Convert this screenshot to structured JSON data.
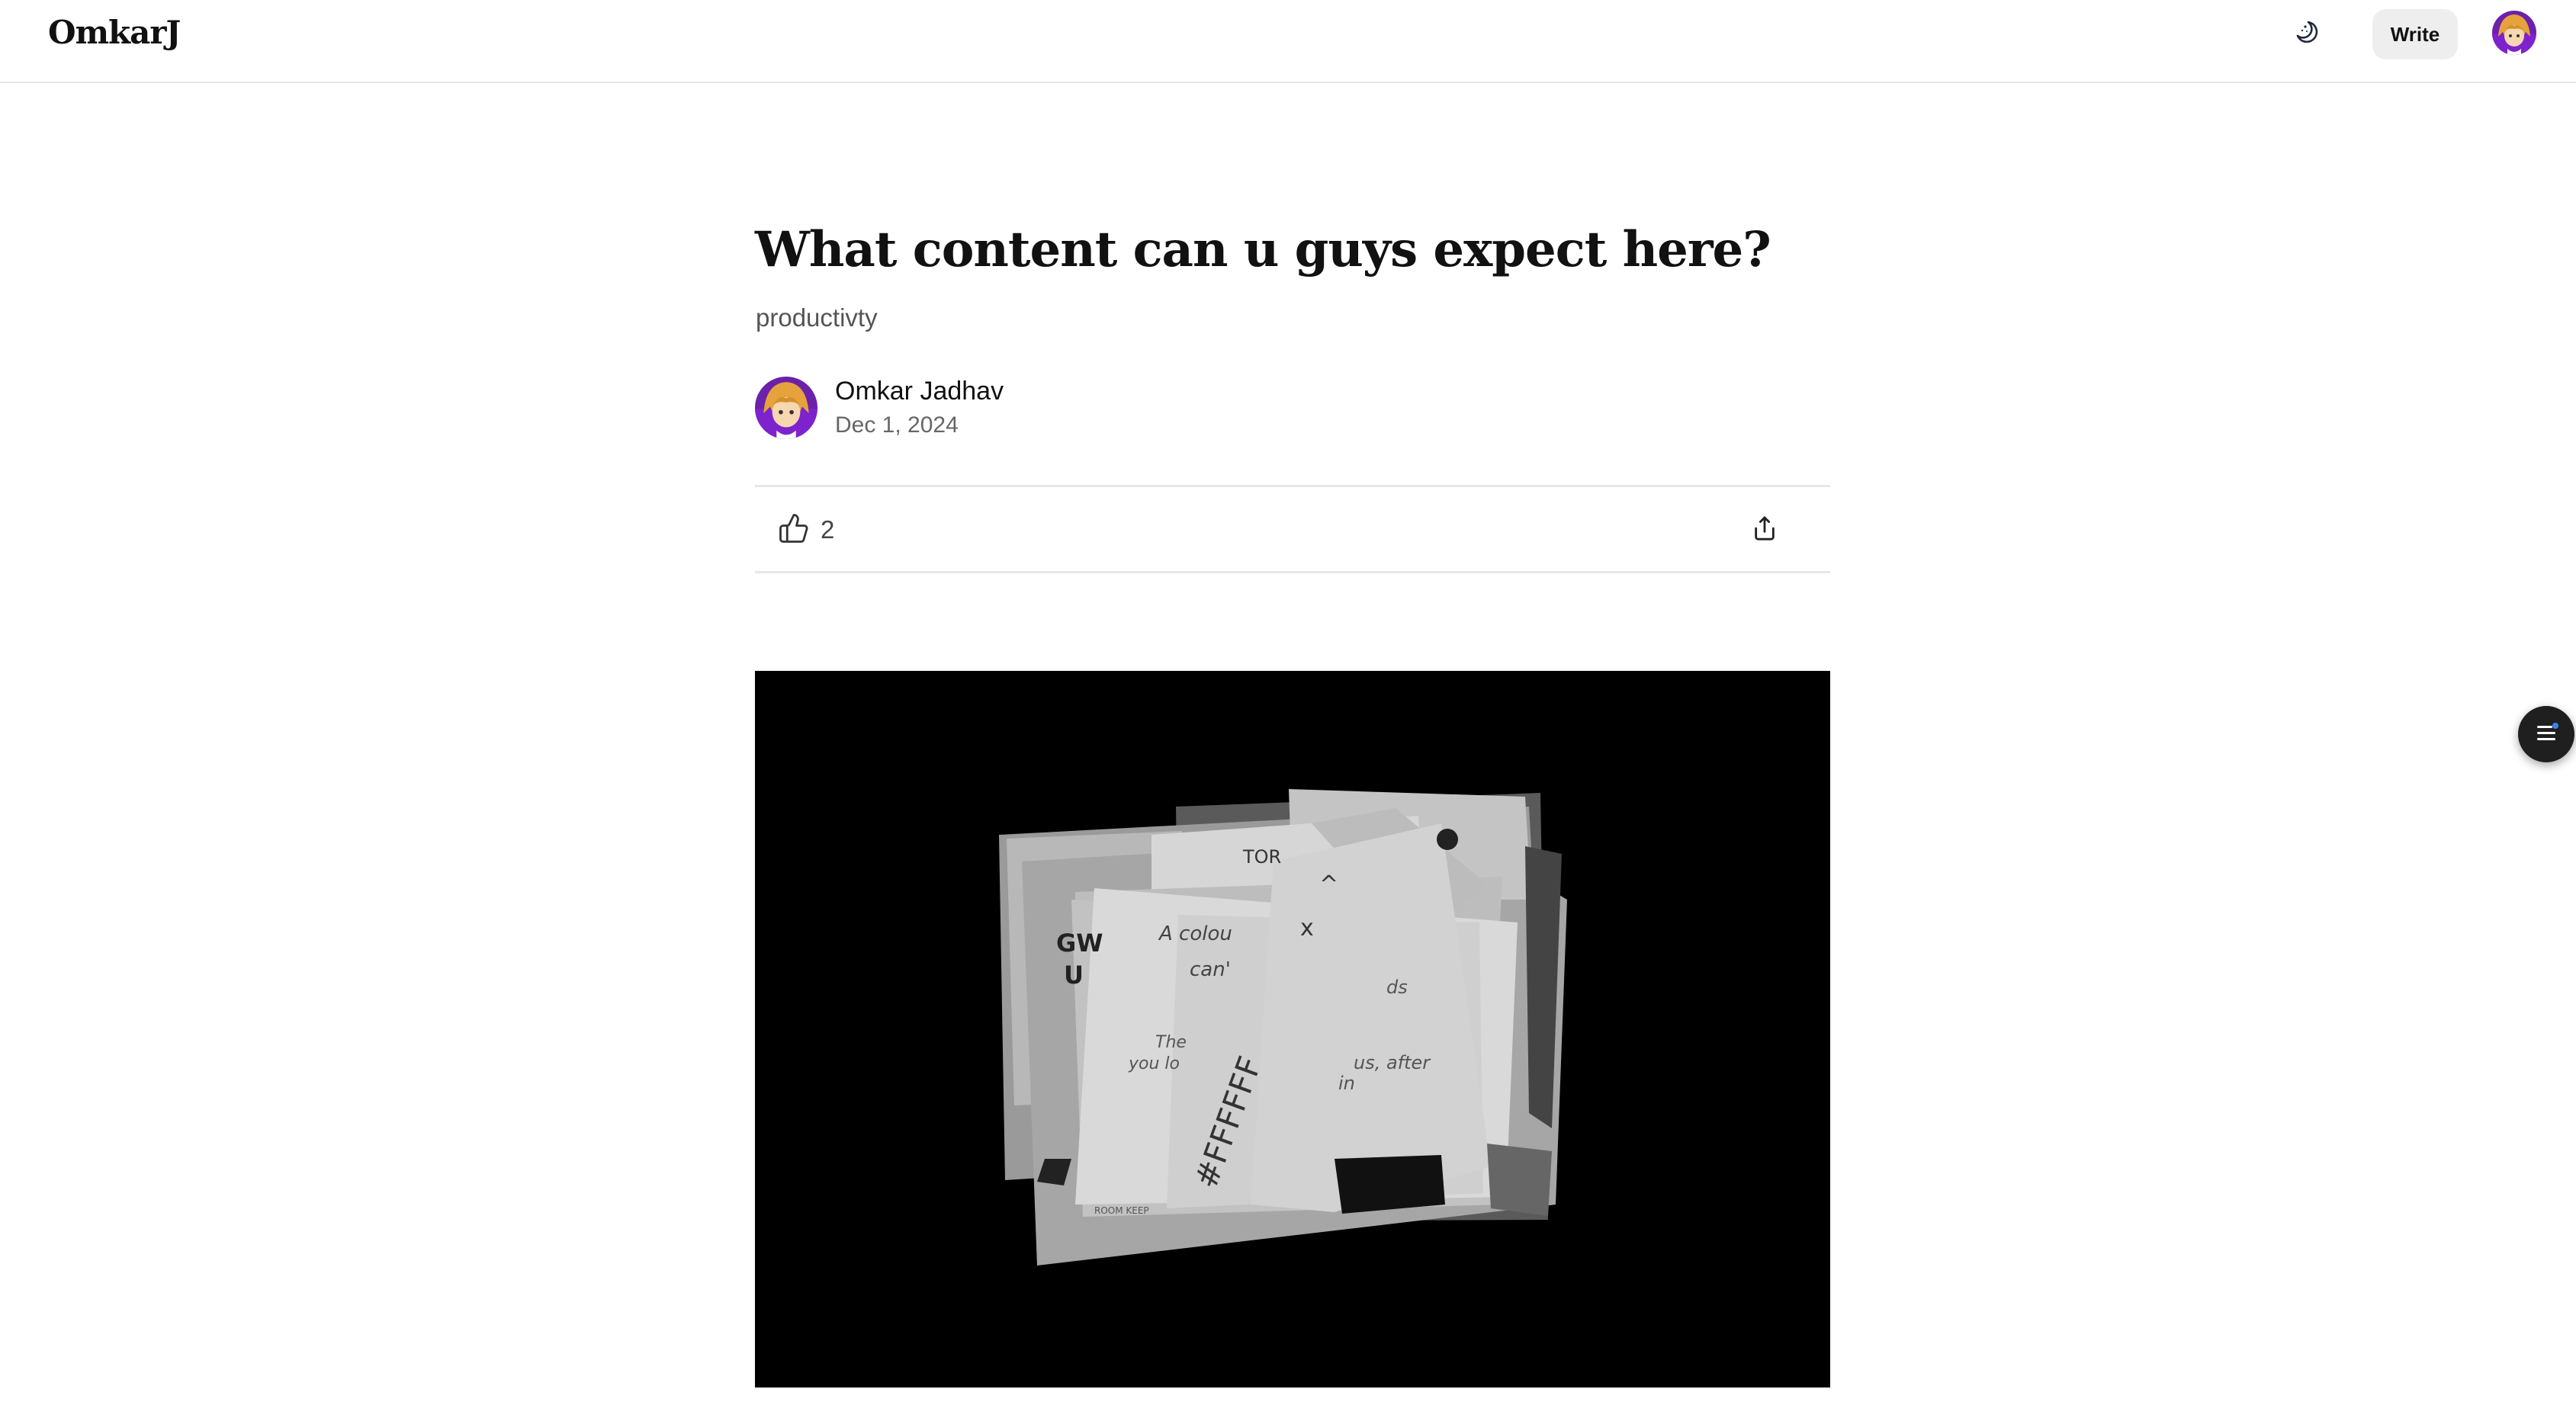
{
  "header": {
    "brand": "OmkarJ",
    "write_label": "Write",
    "theme_icon": "moon-icon",
    "avatar_icon": "anime-avatar"
  },
  "article": {
    "title": "What content can u guys expect here?",
    "subtitle": "productivty",
    "author": {
      "name": "Omkar Jadhav",
      "date": "Dec 1, 2024"
    },
    "likes": "2",
    "like_icon": "thumbs-up-icon",
    "share_icon": "share-icon",
    "cover_image": {
      "description_icon": "scattered-notes-collage",
      "handwritten_words": [
        "A colou",
        "can'",
        "#FFFFFF",
        "ds",
        "us, after",
        "in",
        "The",
        "you lo",
        "GW",
        "U",
        "TOR"
      ]
    }
  },
  "floating": {
    "toc_icon": "table-of-contents-icon"
  },
  "colors": {
    "background": "#ffffff",
    "text": "#111111",
    "muted": "#666666",
    "divider": "#e5e7eb",
    "write_button_bg": "#eeeeee",
    "cover_bg": "#000000",
    "toc_dot": "#3b82f6"
  }
}
